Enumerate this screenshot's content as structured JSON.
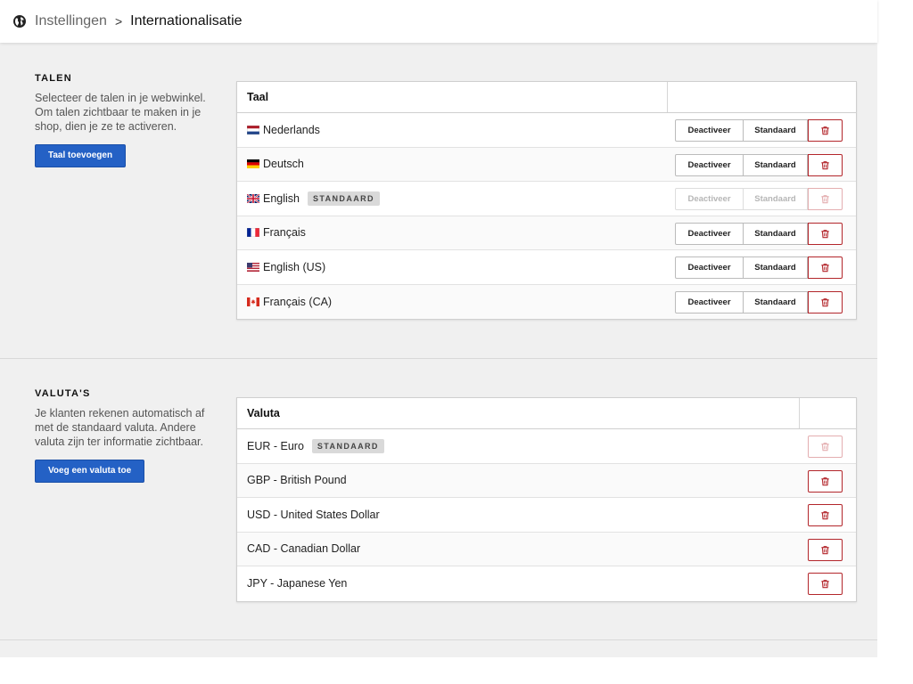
{
  "breadcrumb": {
    "parent": "Instellingen",
    "separator": ">",
    "current": "Internationalisatie"
  },
  "languages": {
    "heading": "TALEN",
    "description": "Selecteer de talen in je webwinkel. Om talen zichtbaar te maken in je shop, dien je ze te activeren.",
    "add_button": "Taal toevoegen",
    "column_header": "Taal",
    "deactivate_label": "Deactiveer",
    "default_label": "Standaard",
    "badge": "STANDAARD",
    "rows": [
      {
        "label": "Nederlands",
        "flag": "nl-flag",
        "is_default": false
      },
      {
        "label": "Deutsch",
        "flag": "de-flag",
        "is_default": false
      },
      {
        "label": "English",
        "flag": "gb-flag",
        "is_default": true
      },
      {
        "label": "Français",
        "flag": "fr-flag",
        "is_default": false
      },
      {
        "label": "English (US)",
        "flag": "us-flag",
        "is_default": false
      },
      {
        "label": "Français (CA)",
        "flag": "ca-flag",
        "is_default": false
      }
    ]
  },
  "currencies": {
    "heading": "VALUTA'S",
    "description": "Je klanten rekenen automatisch af met de standaard valuta. Andere valuta zijn ter informatie zichtbaar.",
    "add_button": "Voeg een valuta toe",
    "column_header": "Valuta",
    "badge": "STANDAARD",
    "rows": [
      {
        "label": "EUR - Euro",
        "is_default": true
      },
      {
        "label": "GBP - British Pound",
        "is_default": false
      },
      {
        "label": "USD - United States Dollar",
        "is_default": false
      },
      {
        "label": "CAD - Canadian Dollar",
        "is_default": false
      },
      {
        "label": "JPY - Japanese Yen",
        "is_default": false
      }
    ]
  },
  "colors": {
    "primary": "#2461c5",
    "danger": "#b3262b",
    "background": "#f0f0f0"
  }
}
